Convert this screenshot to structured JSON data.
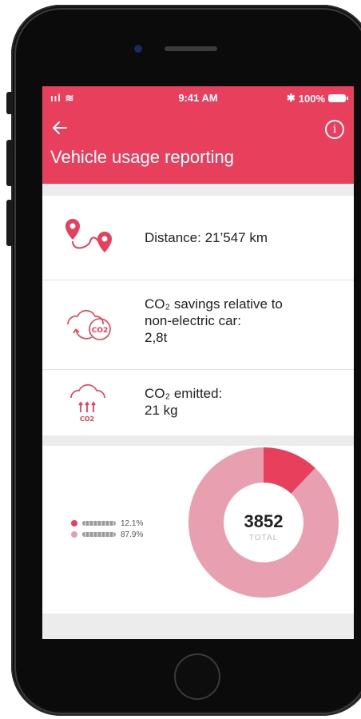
{
  "status_bar": {
    "signal": "ııl",
    "wifi": "≋",
    "time": "9:41 AM",
    "bluetooth": "✱",
    "battery": "100%"
  },
  "header": {
    "title": "Vehicle usage reporting",
    "back_icon": "arrow-left-icon",
    "info_icon": "info-icon",
    "info_glyph": "i"
  },
  "metrics": [
    {
      "icon": "route-pins-icon",
      "text": "Distance: 21’547 km"
    },
    {
      "icon": "co2-cycle-icon",
      "line1": "CO₂ savings relative to",
      "line2": "non-electric car:",
      "line3": "2,8t"
    },
    {
      "icon": "co2-emission-icon",
      "line1": "CO₂ emitted:",
      "line2": "21 kg"
    }
  ],
  "icon_texts": {
    "co2": "CO2"
  },
  "chart_data": {
    "type": "pie",
    "variant": "donut",
    "total_value": "3852",
    "total_label": "TOTAL",
    "series": [
      {
        "percent": "12.1%",
        "value": 12.1,
        "color": "#e8405c"
      },
      {
        "percent": "87.9%",
        "value": 87.9,
        "color": "#e8a0b0"
      }
    ]
  },
  "colors": {
    "accent": "#e8405c",
    "accent_light": "#e8a0b0"
  }
}
